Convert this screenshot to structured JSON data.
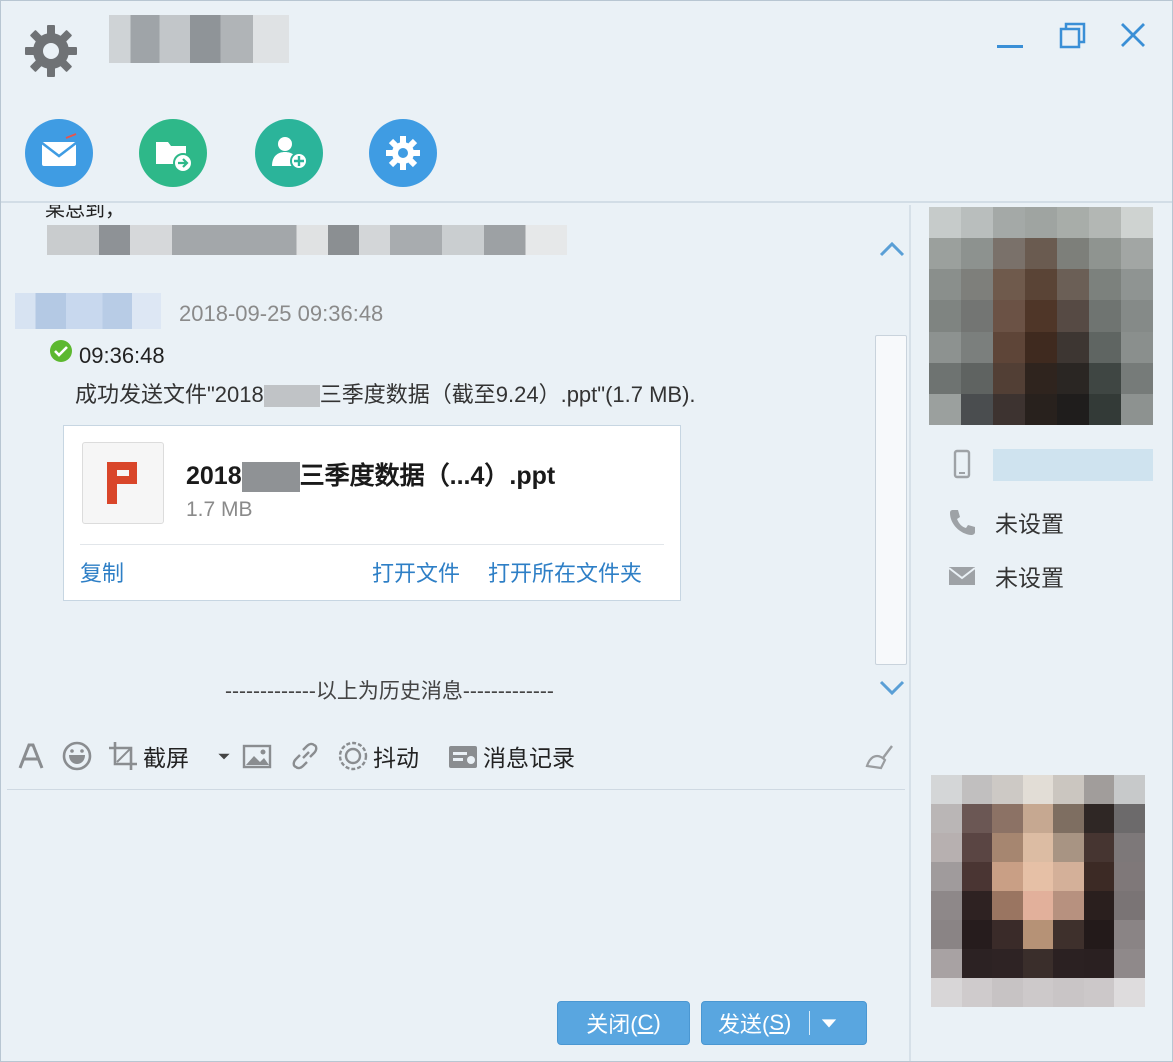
{
  "titlebar": {
    "logo_icon": "gear-icon",
    "minimize_icon": "minimize-icon",
    "restore_icon": "restore-icon",
    "close_icon": "close-icon"
  },
  "toolbar": {
    "buttons": [
      {
        "icon": "mail-icon",
        "color": "#3f9ce3"
      },
      {
        "icon": "folder-transfer-icon",
        "color": "#2eb889"
      },
      {
        "icon": "add-contact-icon",
        "color": "#2bb49a"
      },
      {
        "icon": "settings-icon",
        "color": "#3f9ce3"
      }
    ]
  },
  "chat": {
    "cut_text": "某总到，",
    "message": {
      "timestamp": "2018-09-25 09:36:48",
      "status_time": "09:36:48",
      "success_prefix": "成功发送文件\"2018",
      "success_suffix": "三季度数据（截至9.24）.ppt\"(1.7 MB).",
      "file": {
        "name_prefix": "2018",
        "name_suffix": "三季度数据（...4）.ppt",
        "size": "1.7 MB",
        "icon": "powerpoint-icon",
        "copy_label": "复制",
        "open_label": "打开文件",
        "open_folder_label": "打开所在文件夹"
      }
    },
    "history_separator": "-------------以上为历史消息-------------"
  },
  "input_toolbar": {
    "font_icon": "font-icon",
    "emoji_icon": "emoji-icon",
    "screenshot_icon": "screenshot-icon",
    "screenshot_label": "截屏",
    "dropdown_icon": "dropdown-arrow-icon",
    "image_icon": "image-icon",
    "link_icon": "link-icon",
    "shake_icon": "shake-icon",
    "shake_label": "抖动",
    "history_icon": "message-history-icon",
    "history_label": "消息记录",
    "clear_icon": "clear-icon"
  },
  "buttons": {
    "close_label": "关闭(",
    "close_key": "C",
    "close_end": ")",
    "send_label": "发送(",
    "send_key": "S",
    "send_end": ")"
  },
  "contact": {
    "mobile_icon": "mobile-icon",
    "phone_icon": "phone-icon",
    "phone_value": "未设置",
    "email_icon": "email-icon",
    "email_value": "未设置"
  },
  "colors": {
    "window_bg": "#eaf1f6",
    "link": "#2e7fc6",
    "button": "#59a6e0",
    "ppt_red": "#d9462a"
  }
}
